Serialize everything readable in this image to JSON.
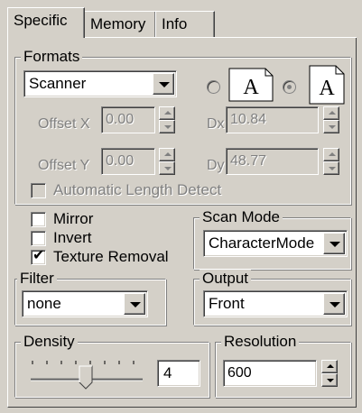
{
  "tabs": [
    "Specific",
    "Memory",
    "Info"
  ],
  "active_tab": "Specific",
  "formats": {
    "legend": "Formats",
    "format_select": "Scanner",
    "orientation_options": [
      "portrait",
      "landscape"
    ],
    "orientation_selected": "landscape",
    "offset_x": {
      "label": "Offset X",
      "value": "0.00"
    },
    "offset_y": {
      "label": "Offset Y",
      "value": "0.00"
    },
    "dx": {
      "label": "Dx",
      "value": "10.84"
    },
    "dy": {
      "label": "Dy",
      "value": "48.77"
    },
    "auto_length": {
      "label": "Automatic Length Detect",
      "checked": false
    }
  },
  "options": {
    "mirror": {
      "label": "Mirror",
      "checked": false
    },
    "invert": {
      "label": "Invert",
      "checked": false
    },
    "texture_removal": {
      "label": "Texture Removal",
      "checked": true
    }
  },
  "scan_mode": {
    "legend": "Scan Mode",
    "value": "CharacterMode"
  },
  "filter": {
    "legend": "Filter",
    "value": "none"
  },
  "output": {
    "legend": "Output",
    "value": "Front"
  },
  "density": {
    "legend": "Density",
    "value": "4",
    "slider_fraction": 0.5
  },
  "resolution": {
    "legend": "Resolution",
    "value": "600"
  },
  "icons": {
    "page_portrait": "page-A-icon",
    "page_landscape": "page-A-icon",
    "dropdown": "chevron-down-icon",
    "spin_up": "triangle-up-icon",
    "spin_down": "triangle-down-icon",
    "checkmark": "checkmark-icon"
  },
  "colors": {
    "face": "#d4d0c8",
    "shadow": "#808080",
    "dark": "#404040",
    "highlight": "#ffffff",
    "disabled": "#808080"
  }
}
